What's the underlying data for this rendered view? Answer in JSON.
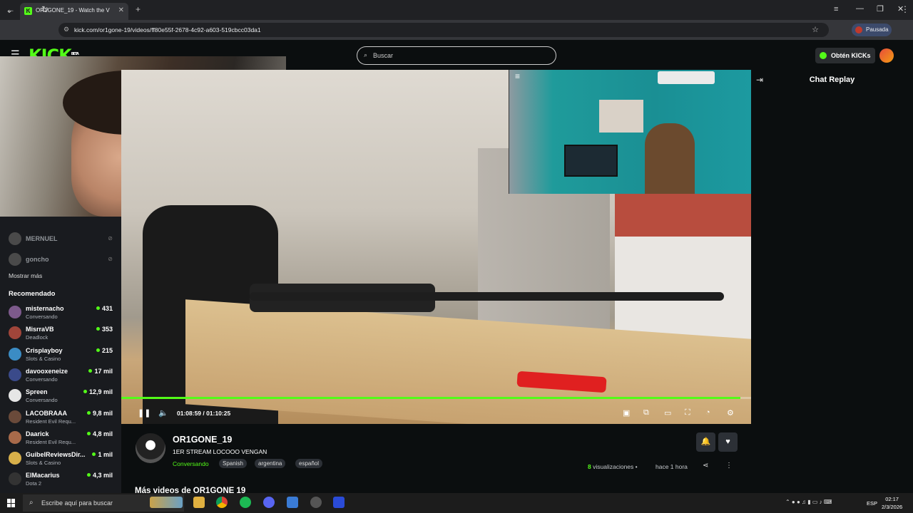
{
  "browser": {
    "tab_title": "OR1GONE_19 - Watch the V",
    "url": "kick.com/or1gone-19/videos/ff80e55f-2678-4c92-a603-519cbcc03da1",
    "profile_label": "Pausada"
  },
  "header": {
    "logo": "KICK",
    "logo_badge": "BETA",
    "search_placeholder": "Buscar",
    "get_kicks_label": "Obtén KICKs"
  },
  "sidebar": {
    "following": [
      {
        "name": "MERNUEL"
      },
      {
        "name": "goncho"
      }
    ],
    "show_more": "Mostrar más",
    "recommended_heading": "Recomendado",
    "recommended": [
      {
        "name": "misternacho",
        "category": "Conversando",
        "viewers": "431",
        "color": "#7d5a8c"
      },
      {
        "name": "MisrraVB",
        "category": "Deadlock",
        "viewers": "353",
        "color": "#a0453a"
      },
      {
        "name": "Crisplayboy",
        "category": "Slots & Casino",
        "viewers": "215",
        "color": "#3b8cc4"
      },
      {
        "name": "davooxeneize",
        "category": "Conversando",
        "viewers": "17 mil",
        "color": "#3a4a8a"
      },
      {
        "name": "Spreen",
        "category": "Conversando",
        "viewers": "12,9 mil",
        "color": "#e6e6e6"
      },
      {
        "name": "LACOBRAAA",
        "category": "Resident Evil Requ...",
        "viewers": "9,8 mil",
        "color": "#6a4a3a"
      },
      {
        "name": "Daarick",
        "category": "Resident Evil Requ...",
        "viewers": "4,8 mil",
        "color": "#a86a4a"
      },
      {
        "name": "GuibelReviewsDir...",
        "category": "Slots & Casino",
        "viewers": "1 mil",
        "color": "#d8b04a"
      },
      {
        "name": "ElMacarius",
        "category": "Dota 2",
        "viewers": "4,3 mil",
        "color": "#333333"
      }
    ]
  },
  "player": {
    "progress": 0.983,
    "current_time": "01:08:59",
    "total_time": "01:10:25",
    "time_separator": "/"
  },
  "chat": {
    "title": "Chat Replay"
  },
  "channel": {
    "name": "OR1GONE_19",
    "stream_title": "1ER STREAM LOCOOO VENGAN",
    "category": "Conversando",
    "tags": [
      "Spanish",
      "argentina",
      "español"
    ],
    "views_count": "8",
    "views_label": "visualizaciones",
    "dot": "•",
    "time_ago": "hace 1 hora",
    "more_videos": "Más videos de OR1GONE 19"
  },
  "taskbar": {
    "search_placeholder": "Escribe aquí para buscar",
    "language": "ESP",
    "time": "02:17",
    "date": "2/3/2026"
  },
  "colors": {
    "accent": "#53fc18",
    "background": "#0b0e0f",
    "sidebar": "#191b1f"
  }
}
